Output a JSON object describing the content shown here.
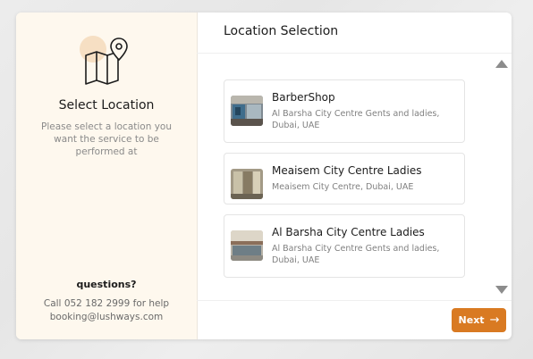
{
  "sidebar": {
    "title": "Select Location",
    "description": "Please select a location you want the service to be performed at",
    "questions_label": "questions?",
    "help_line": "Call 052 182 2999 for help",
    "email": "booking@lushways.com",
    "icon": "map-pin-icon"
  },
  "main": {
    "title": "Location Selection",
    "locations": [
      {
        "name": "BarberShop",
        "address": "Al Barsha City Centre Gents and ladies, Dubai, UAE"
      },
      {
        "name": "Meaisem City Centre Ladies",
        "address": "Meaisem City Centre, Dubai, UAE"
      },
      {
        "name": "Al Barsha City Centre Ladies",
        "address": "Al Barsha City Centre Gents and ladies, Dubai, UAE"
      }
    ],
    "next_label": "Next",
    "next_icon": "→"
  },
  "colors": {
    "accent": "#d97a22",
    "sidebar_bg": "#fef8ee"
  }
}
